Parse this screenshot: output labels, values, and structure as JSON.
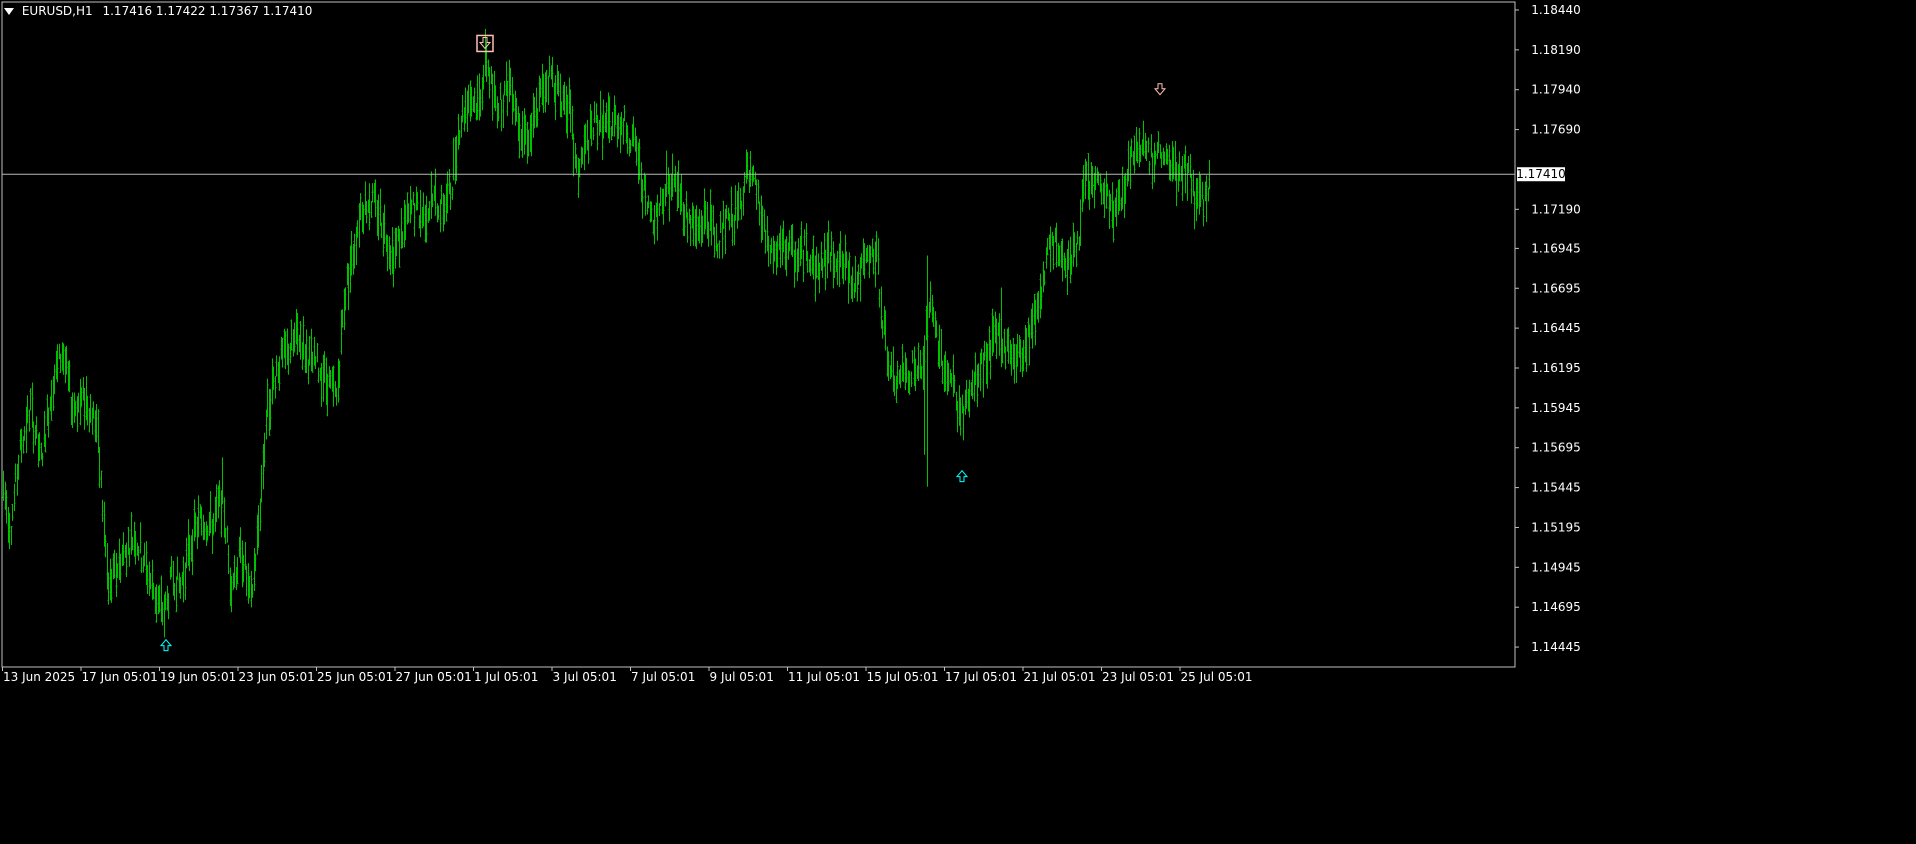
{
  "header": {
    "symbol": "EURUSD,H1",
    "quote": "1.17416 1.17422 1.17367 1.17410"
  },
  "colors": {
    "background": "#000000",
    "bars": "#00c000",
    "axis_text": "#ffffff",
    "frame": "#c0c0c0",
    "current_price_line": "#b8b8b8",
    "down_arrow": "#ffc0b4",
    "up_arrow": "#00ffff"
  },
  "chart_data": {
    "type": "ohlc",
    "grid": false,
    "ylim": [
      1.1432,
      1.1849
    ],
    "y_tick_labels": [
      "1.18440",
      "1.18190",
      "1.17940",
      "1.17690",
      "1.17190",
      "1.16945",
      "1.16695",
      "1.16445",
      "1.16195",
      "1.15945",
      "1.15695",
      "1.15445",
      "1.15195",
      "1.14945",
      "1.14695",
      "1.14445"
    ],
    "x_tick_labels": [
      "13 Jun 2025",
      "17 Jun 05:01",
      "19 Jun 05:01",
      "23 Jun 05:01",
      "25 Jun 05:01",
      "27 Jun 05:01",
      "1 Jul 05:01",
      "3 Jul 05:01",
      "7 Jul 05:01",
      "9 Jul 05:01",
      "11 Jul 05:01",
      "15 Jul 05:01",
      "17 Jul 05:01",
      "21 Jul 05:01",
      "23 Jul 05:01",
      "25 Jul 05:01"
    ],
    "current_price": 1.1741,
    "current_price_label": "1.17410",
    "trend_path": [
      [
        0,
        1.1555
      ],
      [
        10,
        1.152
      ],
      [
        20,
        1.157
      ],
      [
        30,
        1.1595
      ],
      [
        40,
        1.156
      ],
      [
        52,
        1.161
      ],
      [
        62,
        1.163
      ],
      [
        72,
        1.1595
      ],
      [
        85,
        1.16
      ],
      [
        96,
        1.1585
      ],
      [
        108,
        1.148
      ],
      [
        120,
        1.15
      ],
      [
        134,
        1.1515
      ],
      [
        145,
        1.1495
      ],
      [
        156,
        1.1475
      ],
      [
        164,
        1.1465
      ],
      [
        172,
        1.149
      ],
      [
        180,
        1.1482
      ],
      [
        190,
        1.151
      ],
      [
        200,
        1.1525
      ],
      [
        212,
        1.152
      ],
      [
        222,
        1.154
      ],
      [
        230,
        1.1485
      ],
      [
        242,
        1.1505
      ],
      [
        250,
        1.147
      ],
      [
        258,
        1.152
      ],
      [
        266,
        1.159
      ],
      [
        276,
        1.162
      ],
      [
        288,
        1.163
      ],
      [
        298,
        1.164
      ],
      [
        308,
        1.1625
      ],
      [
        318,
        1.162
      ],
      [
        328,
        1.161
      ],
      [
        336,
        1.16
      ],
      [
        344,
        1.1665
      ],
      [
        352,
        1.169
      ],
      [
        360,
        1.172
      ],
      [
        370,
        1.1725
      ],
      [
        380,
        1.1715
      ],
      [
        392,
        1.169
      ],
      [
        402,
        1.1705
      ],
      [
        412,
        1.172
      ],
      [
        422,
        1.1715
      ],
      [
        432,
        1.1725
      ],
      [
        442,
        1.172
      ],
      [
        450,
        1.173
      ],
      [
        458,
        1.177
      ],
      [
        468,
        1.179
      ],
      [
        478,
        1.1785
      ],
      [
        486,
        1.1815
      ],
      [
        492,
        1.179
      ],
      [
        500,
        1.1785
      ],
      [
        510,
        1.18
      ],
      [
        520,
        1.177
      ],
      [
        530,
        1.1765
      ],
      [
        540,
        1.179
      ],
      [
        550,
        1.1805
      ],
      [
        560,
        1.179
      ],
      [
        568,
        1.1785
      ],
      [
        576,
        1.174
      ],
      [
        586,
        1.176
      ],
      [
        596,
        1.1775
      ],
      [
        606,
        1.177
      ],
      [
        616,
        1.1775
      ],
      [
        626,
        1.177
      ],
      [
        636,
        1.1755
      ],
      [
        646,
        1.172
      ],
      [
        656,
        1.1715
      ],
      [
        666,
        1.1735
      ],
      [
        676,
        1.1735
      ],
      [
        686,
        1.1715
      ],
      [
        696,
        1.1705
      ],
      [
        706,
        1.1715
      ],
      [
        716,
        1.17
      ],
      [
        726,
        1.171
      ],
      [
        736,
        1.1715
      ],
      [
        746,
        1.174
      ],
      [
        756,
        1.173
      ],
      [
        766,
        1.1695
      ],
      [
        776,
        1.169
      ],
      [
        786,
        1.1695
      ],
      [
        796,
        1.1688
      ],
      [
        806,
        1.1695
      ],
      [
        816,
        1.168
      ],
      [
        826,
        1.169
      ],
      [
        836,
        1.169
      ],
      [
        846,
        1.168
      ],
      [
        856,
        1.1675
      ],
      [
        866,
        1.1685
      ],
      [
        876,
        1.169
      ],
      [
        884,
        1.164
      ],
      [
        892,
        1.161
      ],
      [
        902,
        1.1615
      ],
      [
        912,
        1.162
      ],
      [
        922,
        1.1615
      ],
      [
        928,
        1.166
      ],
      [
        936,
        1.164
      ],
      [
        944,
        1.162
      ],
      [
        952,
        1.161
      ],
      [
        960,
        1.1588
      ],
      [
        968,
        1.16
      ],
      [
        978,
        1.1615
      ],
      [
        988,
        1.163
      ],
      [
        998,
        1.164
      ],
      [
        1008,
        1.163
      ],
      [
        1018,
        1.1625
      ],
      [
        1028,
        1.164
      ],
      [
        1038,
        1.166
      ],
      [
        1046,
        1.169
      ],
      [
        1056,
        1.1695
      ],
      [
        1066,
        1.1688
      ],
      [
        1076,
        1.1693
      ],
      [
        1084,
        1.1735
      ],
      [
        1094,
        1.1735
      ],
      [
        1104,
        1.1728
      ],
      [
        1114,
        1.1715
      ],
      [
        1124,
        1.1735
      ],
      [
        1134,
        1.176
      ],
      [
        1144,
        1.176
      ],
      [
        1154,
        1.1745
      ],
      [
        1160,
        1.176
      ],
      [
        1168,
        1.1745
      ],
      [
        1178,
        1.1738
      ],
      [
        1188,
        1.1745
      ],
      [
        1196,
        1.172
      ],
      [
        1204,
        1.1725
      ],
      [
        1210,
        1.174
      ]
    ],
    "spikes": [
      {
        "x": 927,
        "low": 1.1545,
        "high": 1.169
      },
      {
        "x": 924,
        "low": 1.1565,
        "high": 1.164
      },
      {
        "x": 1001,
        "low": 1.162,
        "high": 1.167
      }
    ],
    "markers": [
      {
        "type": "down",
        "x": 485,
        "price": 1.1823,
        "boxed": true
      },
      {
        "type": "down",
        "x": 1160,
        "price": 1.1794,
        "boxed": false
      },
      {
        "type": "up",
        "x": 166,
        "price": 1.1446,
        "boxed": false
      },
      {
        "type": "up",
        "x": 962,
        "price": 1.1552,
        "boxed": false
      }
    ]
  }
}
